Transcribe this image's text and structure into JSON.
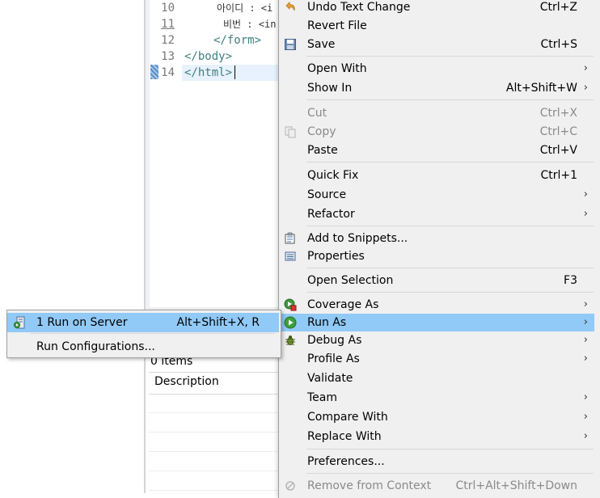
{
  "editor": {
    "lines": [
      {
        "no": "10",
        "text": "아이디 : <i"
      },
      {
        "no": "11",
        "text": "비번 : <in"
      },
      {
        "no": "12",
        "text": "</form>"
      },
      {
        "no": "13",
        "text": "</body>"
      },
      {
        "no": "14",
        "text": "</html>"
      }
    ]
  },
  "problems_view": {
    "items_count": "0 items",
    "column_description": "Description"
  },
  "context_menu": {
    "undo_text_change": {
      "label": "Undo Text Change",
      "shortcut": "Ctrl+Z"
    },
    "revert_file": {
      "label": "Revert File"
    },
    "save": {
      "label": "Save",
      "shortcut": "Ctrl+S"
    },
    "open_with": {
      "label": "Open With"
    },
    "show_in": {
      "label": "Show In",
      "shortcut": "Alt+Shift+W"
    },
    "cut": {
      "label": "Cut",
      "shortcut": "Ctrl+X"
    },
    "copy": {
      "label": "Copy",
      "shortcut": "Ctrl+C"
    },
    "paste": {
      "label": "Paste",
      "shortcut": "Ctrl+V"
    },
    "quick_fix": {
      "label": "Quick Fix",
      "shortcut": "Ctrl+1"
    },
    "source": {
      "label": "Source"
    },
    "refactor": {
      "label": "Refactor"
    },
    "add_to_snippets": {
      "label": "Add to Snippets..."
    },
    "properties": {
      "label": "Properties"
    },
    "open_selection": {
      "label": "Open Selection",
      "shortcut": "F3"
    },
    "coverage_as": {
      "label": "Coverage As"
    },
    "run_as": {
      "label": "Run As"
    },
    "debug_as": {
      "label": "Debug As"
    },
    "profile_as": {
      "label": "Profile As"
    },
    "validate": {
      "label": "Validate"
    },
    "team": {
      "label": "Team"
    },
    "compare_with": {
      "label": "Compare With"
    },
    "replace_with": {
      "label": "Replace With"
    },
    "preferences": {
      "label": "Preferences..."
    },
    "remove_from_context": {
      "label": "Remove from Context",
      "shortcut": "Ctrl+Alt+Shift+Down"
    }
  },
  "run_as_submenu": {
    "run_on_server": {
      "label": "1 Run on Server",
      "shortcut": "Alt+Shift+X, R"
    },
    "run_configurations": {
      "label": "Run Configurations..."
    }
  },
  "arrow_glyph": "›",
  "colors": {
    "highlight": "#91c9f7",
    "menu_bg": "#f0f0f0",
    "tag_color": "#3f7f7f"
  }
}
